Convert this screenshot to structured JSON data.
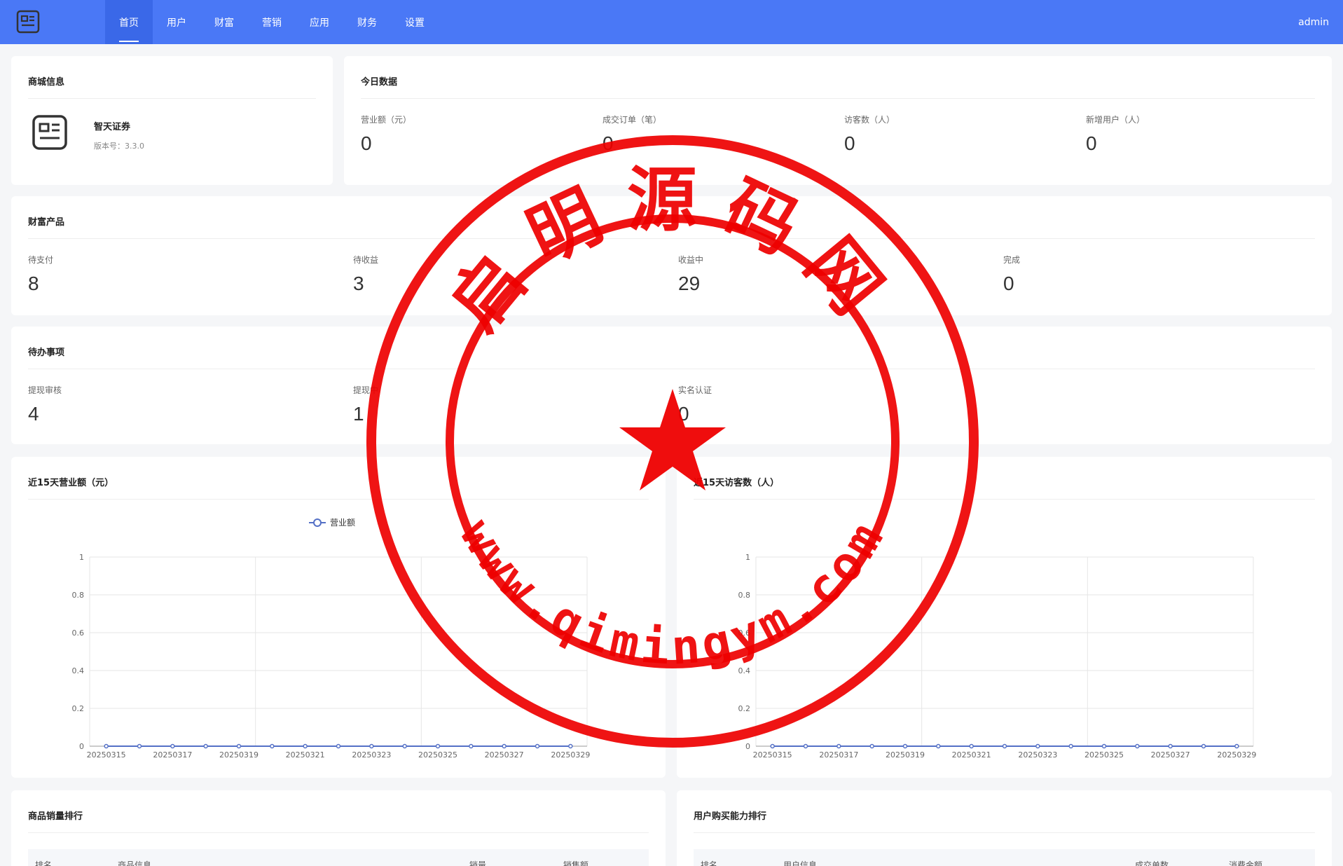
{
  "nav": {
    "items": [
      "首页",
      "用户",
      "财富",
      "营销",
      "应用",
      "财务",
      "设置"
    ],
    "active_index": 0,
    "user": "admin"
  },
  "shop_info": {
    "title": "商城信息",
    "name": "智天证券",
    "version_label": "版本号：",
    "version": "3.3.0"
  },
  "today": {
    "title": "今日数据",
    "stats": [
      {
        "label": "营业额（元）",
        "value": "0"
      },
      {
        "label": "成交订单（笔）",
        "value": "0"
      },
      {
        "label": "访客数（人）",
        "value": "0"
      },
      {
        "label": "新增用户（人）",
        "value": "0"
      }
    ]
  },
  "wealth": {
    "title": "财富产品",
    "stats": [
      {
        "label": "待支付",
        "value": "8"
      },
      {
        "label": "待收益",
        "value": "3"
      },
      {
        "label": "收益中",
        "value": "29"
      },
      {
        "label": "完成",
        "value": "0"
      }
    ]
  },
  "todo": {
    "title": "待办事项",
    "stats": [
      {
        "label": "提现审核",
        "value": "4"
      },
      {
        "label": "提现中",
        "value": "1"
      },
      {
        "label": "实名认证",
        "value": "0"
      }
    ]
  },
  "revenue_chart": {
    "title": "近15天营业额（元）",
    "legend": "营业额"
  },
  "visitor_chart": {
    "title": "近15天访客数（人）"
  },
  "sales_rank": {
    "title": "商品销量排行",
    "columns": [
      "排名",
      "商品信息",
      "销量",
      "销售额"
    ]
  },
  "buyer_rank": {
    "title": "用户购买能力排行",
    "columns": [
      "排名",
      "用户信息",
      "成交单数",
      "消费金额"
    ]
  },
  "stamp": {
    "top_text": "启明源码网",
    "bottom_text": "www.qimingym.com",
    "color": "#ee0000"
  },
  "colors": {
    "nav_bg": "#4a78f6",
    "line": "#5470c6"
  },
  "chart_data": [
    {
      "type": "line",
      "title": "近15天营业额（元）",
      "x": [
        "20250315",
        "20250316",
        "20250317",
        "20250318",
        "20250319",
        "20250320",
        "20250321",
        "20250322",
        "20250323",
        "20250324",
        "20250325",
        "20250326",
        "20250327",
        "20250328",
        "20250329"
      ],
      "x_tick_labels": [
        "20250315",
        "20250317",
        "20250319",
        "20250321",
        "20250323",
        "20250325",
        "20250327",
        "20250329"
      ],
      "series": [
        {
          "name": "营业额",
          "values": [
            0,
            0,
            0,
            0,
            0,
            0,
            0,
            0,
            0,
            0,
            0,
            0,
            0,
            0,
            0
          ]
        }
      ],
      "y_ticks": [
        "0",
        "0.2",
        "0.4",
        "0.6",
        "0.8",
        "1"
      ],
      "ylim": [
        0,
        1
      ],
      "legend_position": "top"
    },
    {
      "type": "line",
      "title": "近15天访客数（人）",
      "x": [
        "20250315",
        "20250316",
        "20250317",
        "20250318",
        "20250319",
        "20250320",
        "20250321",
        "20250322",
        "20250323",
        "20250324",
        "20250325",
        "20250326",
        "20250327",
        "20250328",
        "20250329"
      ],
      "x_tick_labels": [
        "20250315",
        "20250317",
        "20250319",
        "20250321",
        "20250323",
        "20250325",
        "20250327",
        "20250329"
      ],
      "series": [
        {
          "values": [
            0,
            0,
            0,
            0,
            0,
            0,
            0,
            0,
            0,
            0,
            0,
            0,
            0,
            0,
            0
          ]
        }
      ],
      "y_ticks": [
        "0",
        "0.2",
        "0.4",
        "0.6",
        "0.8",
        "1"
      ],
      "ylim": [
        0,
        1
      ]
    }
  ]
}
